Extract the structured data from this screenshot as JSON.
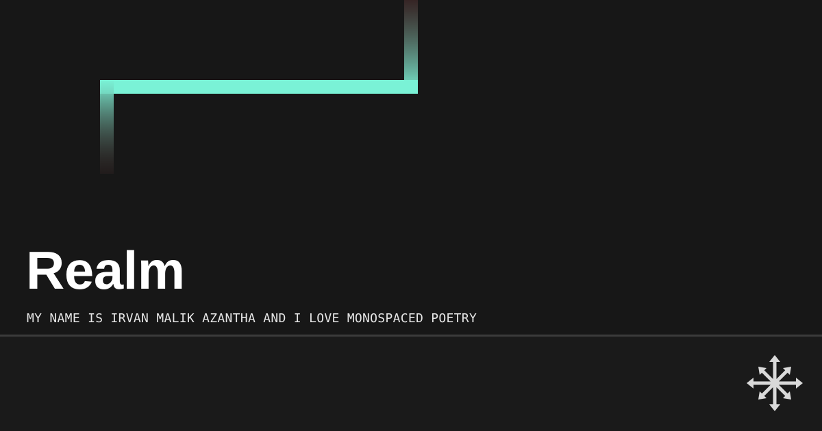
{
  "header": {
    "title": "Realm",
    "subtitle": "MY NAME IS IRVAN MALIK AZANTHA AND I LOVE MONOSPACED POETRY"
  },
  "decoration": {
    "accent_icon": "zigzag-line",
    "accent_color": "#7af2d6",
    "fade_color": "#4a2e2e"
  },
  "footer": {
    "logo_icon": "compass-arrows-icon",
    "logo_color": "#d9d9d9"
  },
  "colors": {
    "background": "#171717",
    "divider": "#3b3b3b",
    "title": "#ffffff"
  }
}
